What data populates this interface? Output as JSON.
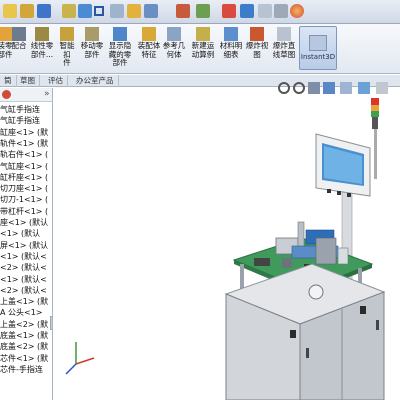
{
  "ribbon": {
    "buttons": [
      {
        "label": "装零\n部件"
      },
      {
        "label": "配合"
      },
      {
        "label": "线性零\n部件..."
      },
      {
        "label": "智能扣\n件"
      },
      {
        "label": "移动零\n部件"
      },
      {
        "label": "显示隐\n藏的零\n部件"
      },
      {
        "label": "装配体\n特征"
      },
      {
        "label": "参考几\n何体"
      },
      {
        "label": "新建运\n动算例"
      },
      {
        "label": "材料明\n细表"
      },
      {
        "label": "爆炸视\n图"
      },
      {
        "label": "爆炸直\n线草图"
      }
    ],
    "instant3d": "Instant3D"
  },
  "tabs": [
    "筒",
    "草图",
    "评估",
    "办公室产品"
  ],
  "tree": {
    "items": [
      "气缸手指连",
      "气缸手指连",
      "缸座<1> (默",
      "轨件<1> (默",
      "轨右件<1> (",
      "气缸座<1> (",
      "缸杆座<1> (",
      "切刀座<1> (",
      "切刀-1<1> (",
      "带杠杆<1> (",
      "座<1> (默认",
      "<1> (默认",
      "屏<1> (默认",
      "<1> (默认<",
      "<2> (默认<",
      "<1> (默认<",
      "<2> (默认<",
      "上盖<1> (默",
      "A 公头<1>",
      "上盖<2> (默",
      "底盖<1> (默",
      "底盖<2> (默",
      "芯件<1> (默",
      "芯件-手指连"
    ]
  },
  "colors": {
    "accent": "#2f6fd1",
    "plate": "#3f9a5c",
    "frame": "#cfd3d8"
  }
}
